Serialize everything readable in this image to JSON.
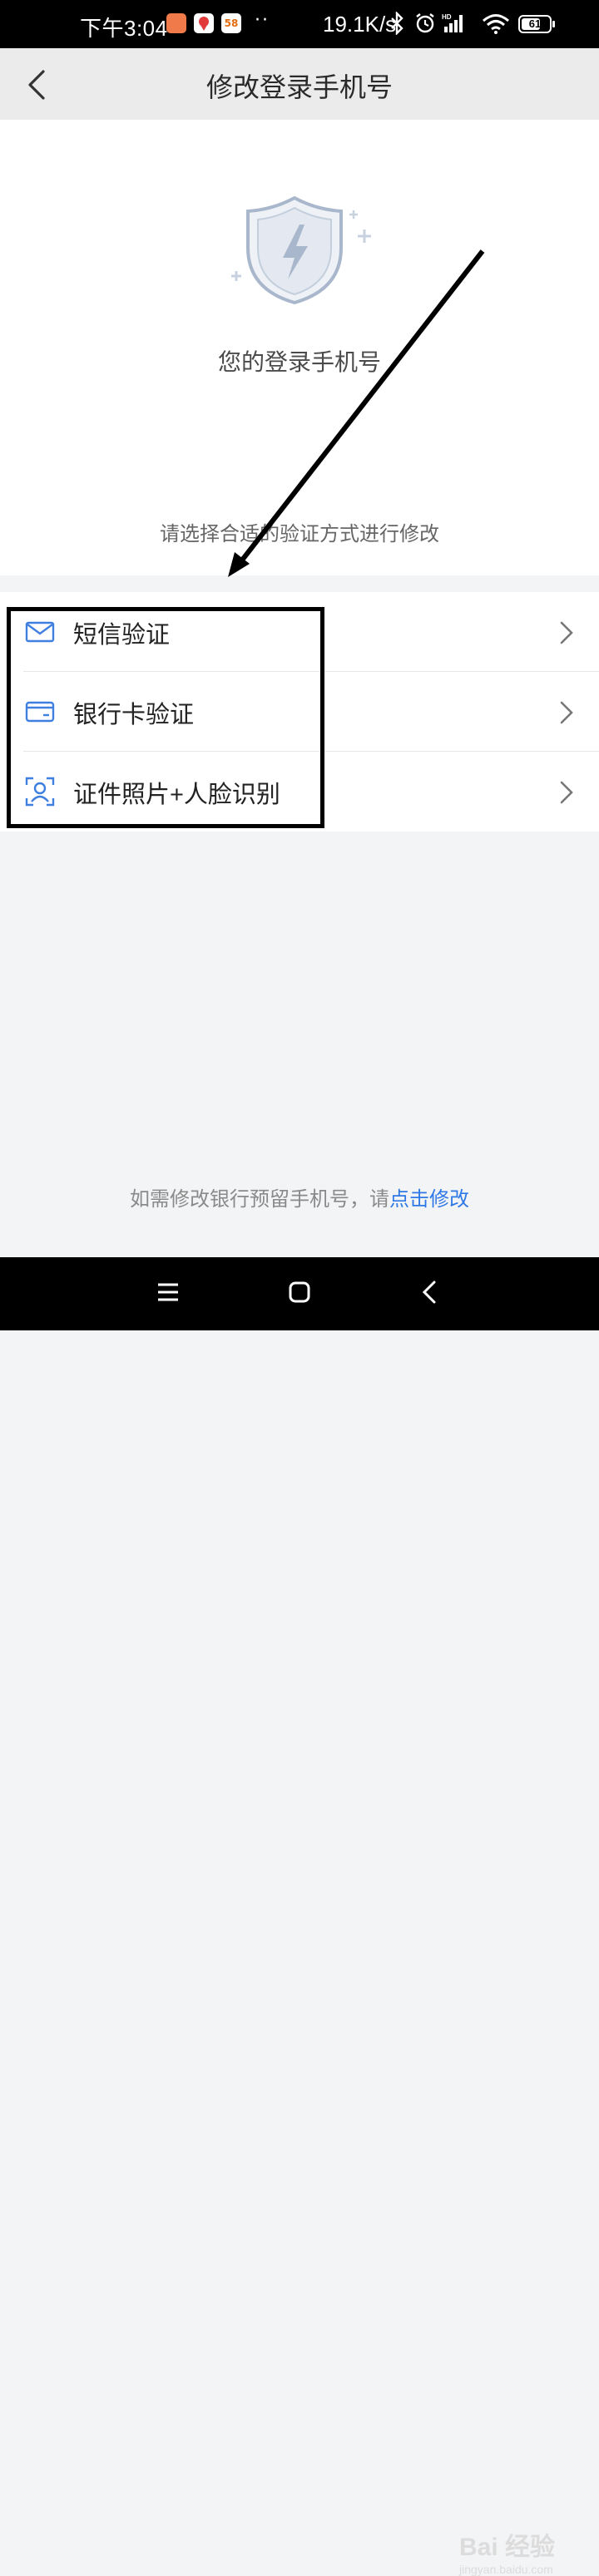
{
  "status_bar": {
    "time": "下午3:04",
    "network_speed": "19.1K/s",
    "battery": "61",
    "app_icons": [
      "health-app-icon",
      "map-app-icon",
      "58-app-icon"
    ],
    "app_icon_label_58": "58"
  },
  "header": {
    "title": "修改登录手机号"
  },
  "hero": {
    "phone_label": "您的登录手机号",
    "hint": "请选择合适的验证方式进行修改"
  },
  "methods": [
    {
      "label": "短信验证",
      "icon": "mail-icon"
    },
    {
      "label": "银行卡验证",
      "icon": "bank-card-icon"
    },
    {
      "label": "证件照片+人脸识别",
      "icon": "face-id-icon"
    }
  ],
  "footer": {
    "note_prefix": "如需修改银行预留手机号，请",
    "note_link": "点击修改"
  },
  "watermark": {
    "logo": "Bai 经验",
    "url": "jingyan.baidu.com"
  },
  "colors": {
    "accent": "#2f79e6",
    "annotation": "#000000"
  }
}
